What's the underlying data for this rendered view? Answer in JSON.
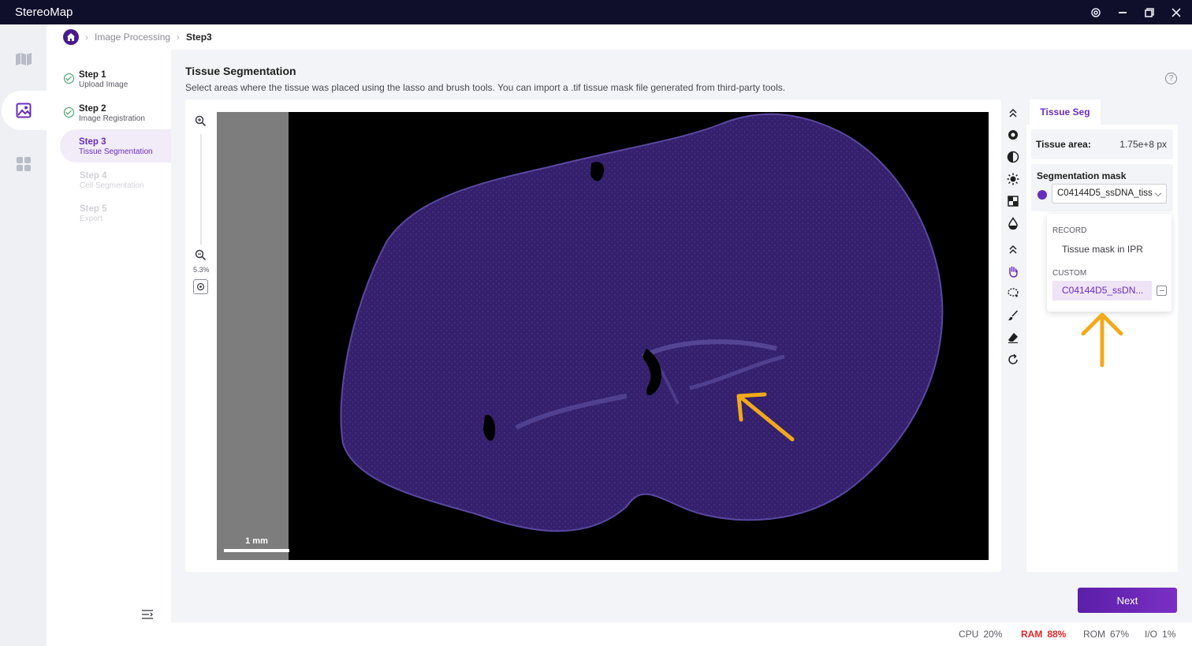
{
  "app": {
    "title": "StereoMap"
  },
  "breadcrumb": {
    "items": [
      "Image Processing",
      "Step3"
    ]
  },
  "steps": [
    {
      "title": "Step 1",
      "subtitle": "Upload Image",
      "state": "done"
    },
    {
      "title": "Step 2",
      "subtitle": "Image Registration",
      "state": "done"
    },
    {
      "title": "Step 3",
      "subtitle": "Tissue Segmentation",
      "state": "current"
    },
    {
      "title": "Step 4",
      "subtitle": "Cell Segmentation",
      "state": "disabled"
    },
    {
      "title": "Step 5",
      "subtitle": "Export",
      "state": "disabled"
    }
  ],
  "main": {
    "title": "Tissue Segmentation",
    "description": "Select areas where the tissue was placed using the lasso and brush tools. You can import a .tif tissue mask file generated from third-party tools."
  },
  "viewer": {
    "zoom_level": "5.3%",
    "scale_bar": "1 mm"
  },
  "panel": {
    "tab": "Tissue Seg",
    "tissue_area_label": "Tissue area:",
    "tissue_area_value": "1.75e+8 px",
    "mask_label": "Segmentation mask",
    "mask_value": "C04144D5_ssDNA_tiss",
    "dropdown": {
      "group_record": "RECORD",
      "record_item": "Tissue mask in IPR",
      "group_custom": "CUSTOM",
      "custom_item": "C04144D5_ssDN..."
    }
  },
  "actions": {
    "next": "Next"
  },
  "status": {
    "cpu_label": "CPU",
    "cpu_value": "20%",
    "ram_label": "RAM",
    "ram_value": "88%",
    "rom_label": "ROM",
    "rom_value": "67%",
    "io_label": "I/O",
    "io_value": "1%"
  },
  "colors": {
    "accent": "#6a2dbd",
    "titlebar": "#0f0e2b",
    "tissue": "#3a2370",
    "warning": "#e0262b",
    "annotation": "#f2a91b"
  }
}
